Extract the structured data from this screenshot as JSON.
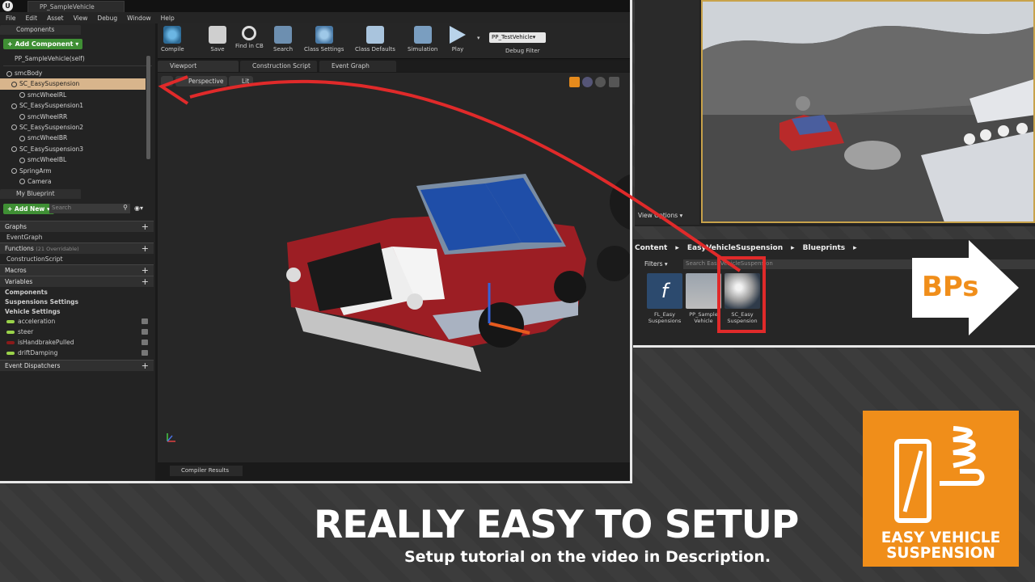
{
  "titlebar": {
    "tab": "PP_SampleVehicle"
  },
  "menu": [
    "File",
    "Edit",
    "Asset",
    "View",
    "Debug",
    "Window",
    "Help"
  ],
  "components": {
    "tab": "Components",
    "add_button": "+ Add Component ▾",
    "self": "PP_SampleVehicle(self)",
    "tree": [
      "smcBody",
      "SC_EasySuspension",
      "smcWheelRL",
      "SC_EasySuspension1",
      "smcWheelRR",
      "SC_EasySuspension2",
      "smcWheelBR",
      "SC_EasySuspension3",
      "smcWheelBL",
      "SpringArm",
      "Camera"
    ]
  },
  "my_blueprint": {
    "tab": "My Blueprint",
    "add_new": "+ Add New ▾",
    "search_placeholder": "Search",
    "graphs": "Graphs",
    "event_graph": "EventGraph",
    "functions": "Functions",
    "functions_count": "(21 Overridable)",
    "construction_script": "ConstructionScript",
    "macros": "Macros",
    "variables": "Variables",
    "var_components": "Components",
    "var_susp": "Suspensions Settings",
    "var_vehicle": "Vehicle Settings",
    "vars": [
      "acceleration",
      "steer",
      "isHandbrakePulled",
      "driftDamping"
    ],
    "event_dispatchers": "Event Dispatchers"
  },
  "toolbar": {
    "compile": "Compile",
    "save": "Save",
    "find": "Find in CB",
    "search": "Search",
    "class_settings": "Class Settings",
    "class_defaults": "Class Defaults",
    "simulation": "Simulation",
    "play": "Play",
    "debug_value": "PP_TestVehicle▾",
    "debug_filter": "Debug Filter"
  },
  "editor_tabs": {
    "viewport": "Viewport",
    "construction": "Construction Script",
    "event_graph": "Event Graph"
  },
  "viewport": {
    "perspective": "Perspective",
    "lit": "Lit"
  },
  "compiler_results": "Compiler Results",
  "game": {
    "view_options": "View Options ▾"
  },
  "content_browser": {
    "crumbs": [
      "Content",
      "EasyVehicleSuspension",
      "Blueprints"
    ],
    "filters": "Filters ▾",
    "search_placeholder": "Search EasyVehicleSuspension",
    "assets": [
      {
        "l1": "FL_Easy",
        "l2": "Suspensions"
      },
      {
        "l1": "PP_Sample",
        "l2": "Vehicle"
      },
      {
        "l1": "SC_Easy",
        "l2": "Suspension"
      }
    ]
  },
  "bps_label": "BPs",
  "headline": "REALLY EASY TO SETUP",
  "subline": "Setup tutorial on the video in Description.",
  "logo": {
    "line1": "EASY VEHICLE",
    "line2": "SUSPENSION"
  },
  "colors": {
    "accent_red": "#e02a2a",
    "orange": "#f08e1a",
    "green": "#3f8f34"
  }
}
